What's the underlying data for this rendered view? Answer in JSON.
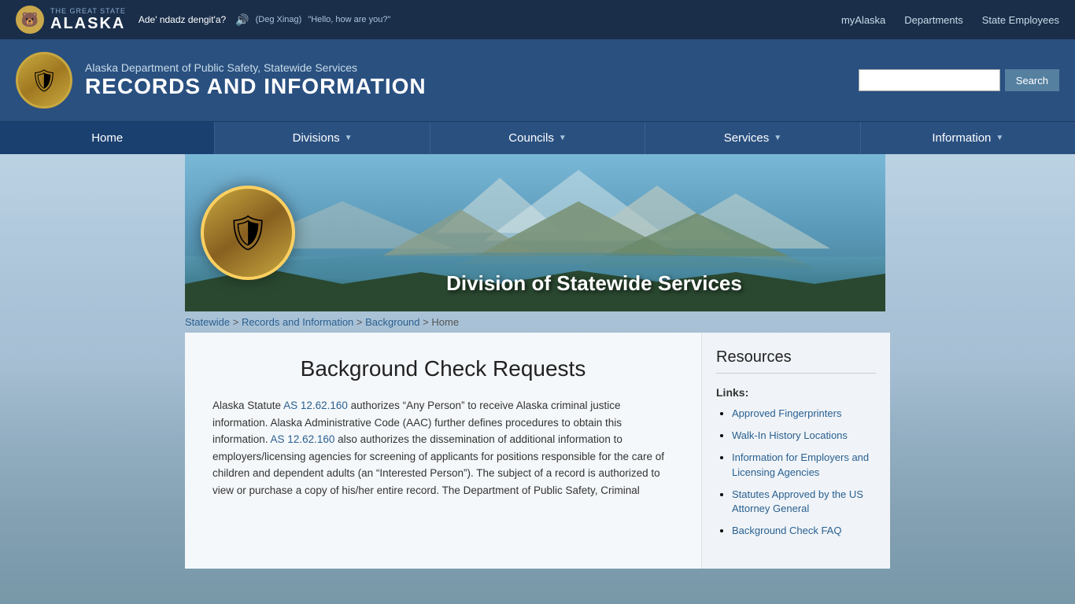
{
  "topbar": {
    "great_state_label": "THE GREAT STATE",
    "alaska_label": "ALASKA",
    "native_phrase": "Ade' ndadz dengit'a?",
    "native_language": "(Deg Xinag)",
    "native_translation": "\"Hello, how are you?\"",
    "links": [
      {
        "label": "myAlaska",
        "href": "#"
      },
      {
        "label": "Departments",
        "href": "#"
      },
      {
        "label": "State Employees",
        "href": "#"
      }
    ]
  },
  "header": {
    "badge_icon": "🛡",
    "subtitle": "Alaska Department of Public Safety, Statewide Services",
    "main_title": "RECORDS AND INFORMATION",
    "search_placeholder": "",
    "search_button_label": "Search"
  },
  "nav": {
    "items": [
      {
        "label": "Home",
        "has_arrow": false
      },
      {
        "label": "Divisions",
        "has_arrow": true
      },
      {
        "label": "Councils",
        "has_arrow": true
      },
      {
        "label": "Services",
        "has_arrow": true
      },
      {
        "label": "Information",
        "has_arrow": true
      }
    ]
  },
  "hero": {
    "division_text": "Division of Statewide Services"
  },
  "breadcrumb": {
    "items": [
      {
        "label": "Statewide",
        "href": "#"
      },
      {
        "label": "Records and Information",
        "href": "#"
      },
      {
        "label": "Background",
        "href": "#"
      },
      {
        "label": "Home",
        "href": null
      }
    ]
  },
  "main": {
    "title": "Background Check Requests",
    "statute_link1": "AS 12.62.160",
    "statute_link2": "AS 12.62.160",
    "paragraph": " authorizes “Any Person” to receive Alaska criminal justice information. Alaska Administrative Code (AAC) further defines procedures to obtain this information. ",
    "paragraph2": " also authorizes the dissemination of additional information to employers/licensing agencies for screening of applicants for positions responsible for the care of children and dependent adults (an “Interested Person”). The subject of a record is authorized to view or purchase a copy of his/her entire record. The Department of Public Safety, Criminal"
  },
  "sidebar": {
    "title": "Resources",
    "links_label": "Links:",
    "links": [
      {
        "label": "Approved Fingerprinters",
        "href": "#"
      },
      {
        "label": "Walk-In History Locations",
        "href": "#"
      },
      {
        "label": "Information for Employers and Licensing Agencies",
        "href": "#"
      },
      {
        "label": "Statutes Approved by the US Attorney General",
        "href": "#"
      },
      {
        "label": "Background Check FAQ",
        "href": "#"
      }
    ]
  }
}
